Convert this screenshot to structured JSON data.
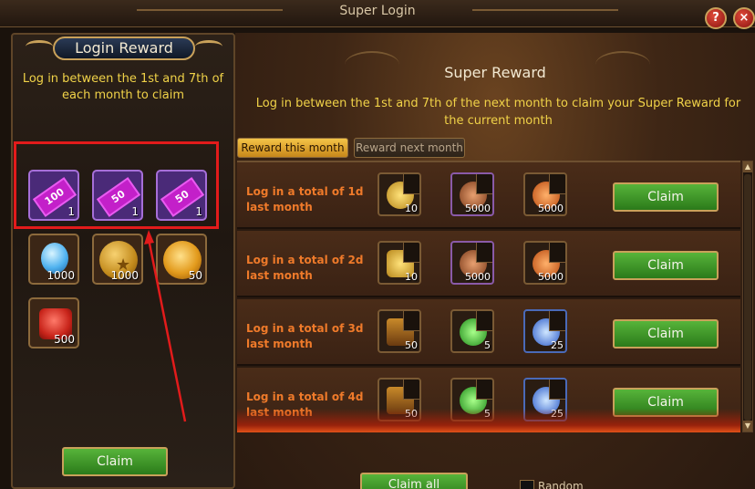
{
  "window": {
    "title": "Super Login",
    "help_symbol": "?",
    "close_symbol": "×"
  },
  "left": {
    "header": "Login Reward",
    "description": "Log in between the 1st and 7th of each month to claim",
    "items": [
      {
        "name": "ticket-100",
        "label": "100",
        "qty": "1",
        "icon": "purple-ticket-icon"
      },
      {
        "name": "ticket-50a",
        "label": "50",
        "qty": "1",
        "icon": "purple-ticket-icon"
      },
      {
        "name": "ticket-50b",
        "label": "50",
        "qty": "1",
        "icon": "purple-ticket-icon"
      },
      {
        "name": "blue-gem",
        "qty": "1000",
        "icon": "blue-crystal-icon"
      },
      {
        "name": "gold-coin",
        "qty": "1000",
        "icon": "gold-coin-icon"
      },
      {
        "name": "gold-orb",
        "qty": "50",
        "icon": "gold-orb-icon"
      },
      {
        "name": "heart-box",
        "qty": "500",
        "icon": "heart-gift-icon"
      }
    ],
    "claim_label": "Claim"
  },
  "right": {
    "title": "Super Reward",
    "description": "Log in between the 1st and 7th of the next month to claim your Super Reward for the current month",
    "tabs": [
      {
        "label": "Reward this month",
        "active": true
      },
      {
        "label": "Reward next month",
        "active": false
      }
    ],
    "rows": [
      {
        "label_line1": "Log in a total of 1d",
        "label_line2": "last month",
        "items": [
          {
            "qty": "10",
            "icon": "golden-relic-icon"
          },
          {
            "qty": "5000",
            "icon": "purple-shard-icon"
          },
          {
            "qty": "5000",
            "icon": "fire-ring-icon"
          }
        ],
        "claim_label": "Claim"
      },
      {
        "label_line1": "Log in a total of 2d",
        "label_line2": "last month",
        "items": [
          {
            "qty": "10",
            "icon": "hourglass-icon"
          },
          {
            "qty": "5000",
            "icon": "purple-shard-icon"
          },
          {
            "qty": "5000",
            "icon": "fire-ring-icon"
          }
        ],
        "claim_label": "Claim"
      },
      {
        "label_line1": "Log in a total of 3d",
        "label_line2": "last month",
        "items": [
          {
            "qty": "50",
            "icon": "treasure-chest-icon"
          },
          {
            "qty": "5",
            "icon": "green-crystal-icon"
          },
          {
            "qty": "25",
            "icon": "blue-wing-icon"
          }
        ],
        "claim_label": "Claim"
      },
      {
        "label_line1": "Log in a total of 4d",
        "label_line2": "last month",
        "items": [
          {
            "qty": "50",
            "icon": "treasure-chest-icon"
          },
          {
            "qty": "5",
            "icon": "green-crystal-icon"
          },
          {
            "qty": "25",
            "icon": "blue-wing-icon"
          }
        ],
        "claim_label": "Claim"
      }
    ],
    "claim_all_label": "Claim all",
    "random_label": "Random"
  },
  "colors": {
    "accent_gold": "#c9a15a",
    "highlight_red": "#e21b1b",
    "desc_yellow": "#f0d248",
    "row_label_orange": "#ef7a2a",
    "claim_green": "#3e9a28"
  }
}
